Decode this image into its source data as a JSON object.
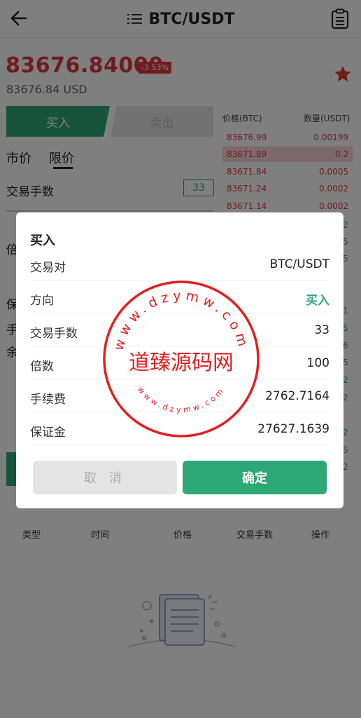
{
  "header": {
    "title": "BTC/USDT",
    "back_icon": "arrow-left-icon",
    "menu_icon": "list-icon",
    "orders_icon": "clipboard-icon"
  },
  "price": {
    "last": "83676.84000",
    "change": "-3.53%",
    "usd": "83676.84 USD",
    "color": "#e0393e"
  },
  "trade_panel": {
    "buy_label": "买入",
    "sell_label": "卖出",
    "market_label": "市价",
    "limit_label": "限价",
    "lots_label": "交易手数",
    "lots_value": "33",
    "peek_labels": [
      "倍",
      "保",
      "手",
      "余"
    ]
  },
  "order_book": {
    "price_header": "价格(BTC)",
    "qty_header": "数量(USDT)",
    "asks": [
      {
        "price": "83676.99",
        "qty": "0.00199"
      },
      {
        "price": "83671.89",
        "qty": "0.2"
      },
      {
        "price": "83671.84",
        "qty": "0.0005"
      },
      {
        "price": "83671.24",
        "qty": "0.0002"
      },
      {
        "price": "83671.14",
        "qty": "0.0002"
      }
    ],
    "side_digits": [
      "2",
      "5",
      "5",
      "1",
      "5",
      "6",
      "5",
      "2",
      "2",
      "2",
      "5",
      "2"
    ]
  },
  "table_header": {
    "type": "类型",
    "time": "时间",
    "price": "价格",
    "lots": "交易手数",
    "action": "操作"
  },
  "modal": {
    "title": "买入",
    "rows": [
      {
        "label": "交易对",
        "value": "BTC/USDT"
      },
      {
        "label": "方向",
        "value": "买入"
      },
      {
        "label": "交易手数",
        "value": "33"
      },
      {
        "label": "倍数",
        "value": "100"
      },
      {
        "label": "手续费",
        "value": "2762.7164"
      },
      {
        "label": "保证金",
        "value": "27627.1639"
      }
    ],
    "cancel_label": "取 消",
    "confirm_label": "确定"
  },
  "watermark": {
    "center_text": "道臻源码网",
    "ring_text": "www.dzymw.com",
    "color": "#e02020"
  },
  "colors": {
    "green": "#2ea877",
    "red": "#e0393e"
  }
}
